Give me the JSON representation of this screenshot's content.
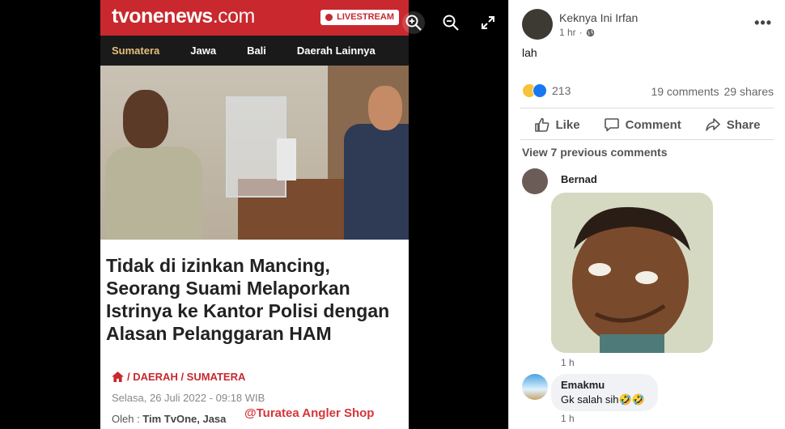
{
  "article": {
    "brand": "tvonenews",
    "brand_suffix": ".com",
    "live_label": "LIVESTREAM",
    "nav": [
      "Sumatera",
      "Jawa",
      "Bali",
      "Daerah Lainnya"
    ],
    "headline": "Tidak di izinkan Mancing, Seorang Suami Melaporkan Istrinya ke Kantor Polisi dengan Alasan Pelanggaran HAM",
    "breadcrumb": "/ DAERAH / SUMATERA",
    "date": "Selasa, 26 Juli 2022 - 09:18 WIB",
    "author_prefix": "Oleh : ",
    "author": "Tim TvOne",
    "author_suffix": ", Jasa",
    "watermark": "@Turatea Angler Shop"
  },
  "viewer_tools": [
    "zoom-in-icon",
    "zoom-out-icon",
    "fullscreen-icon"
  ],
  "post": {
    "author": "Keknya Ini Irfan",
    "time": "1 hr",
    "privacy_icon": "globe-icon",
    "more": "•••",
    "text": "lah",
    "reaction_count": "213",
    "comments_count": "19 comments",
    "shares_count": "29 shares",
    "actions": {
      "like": "Like",
      "comment": "Comment",
      "share": "Share"
    }
  },
  "comments": {
    "view_previous": "View 7 previous comments",
    "items": [
      {
        "author": "Bernad",
        "type": "sticker",
        "time": "1 h"
      },
      {
        "author": "Emakmu",
        "text": "Gk salah sih🤣🤣",
        "time": "1 h"
      }
    ]
  },
  "colors": {
    "brand_red": "#c8282e",
    "nav_active": "#e4c07c",
    "fb_text_secondary": "#65676b"
  }
}
